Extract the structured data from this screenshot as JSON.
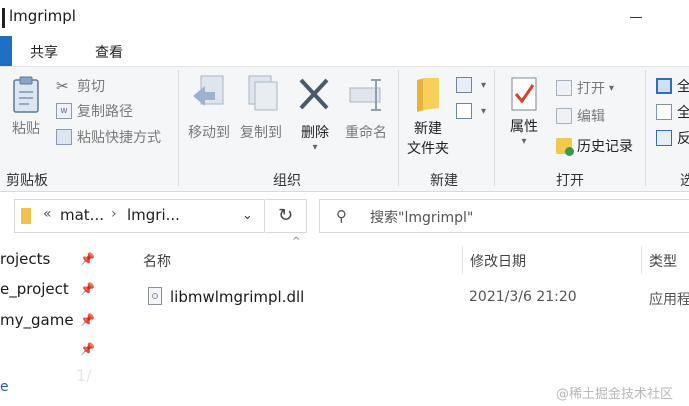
{
  "window": {
    "title": "lmgrimpl"
  },
  "ribbon_tabs": [
    "共享",
    "查看"
  ],
  "ribbon": {
    "clipboard": {
      "label": "剪贴板",
      "paste": "粘贴",
      "cut": "剪切",
      "copy_path": "复制路径",
      "paste_shortcut": "粘贴快捷方式"
    },
    "organize": {
      "label": "组织",
      "move_to": "移动到",
      "copy_to": "复制到",
      "delete": "删除",
      "rename": "重命名"
    },
    "new": {
      "label": "新建",
      "new_folder_line1": "新建",
      "new_folder_line2": "文件夹"
    },
    "open": {
      "label": "打开",
      "properties": "属性",
      "open": "打开",
      "edit": "编辑",
      "history": "历史记录"
    },
    "select": {
      "label": "选",
      "all1": "全",
      "all2": "全",
      "invert": "反"
    }
  },
  "address": {
    "path_prefix": "«",
    "crumb1": "mat...",
    "crumb2": "lmgri..."
  },
  "search": {
    "placeholder": "搜索\"lmgrimpl\""
  },
  "nav": {
    "items": [
      {
        "label": "rojects"
      },
      {
        "label": "e_project"
      },
      {
        "label": "my_game"
      },
      {
        "label": ""
      }
    ],
    "bottom_letter": "e"
  },
  "columns": {
    "name": "名称",
    "date": "修改日期",
    "type": "类型"
  },
  "files": [
    {
      "name": "libmwlmgrimpl.dll",
      "date": "2021/3/6 21:20",
      "type": "应用程"
    }
  ],
  "watermark": "@稀土掘金技术社区",
  "faint_text": "1/"
}
